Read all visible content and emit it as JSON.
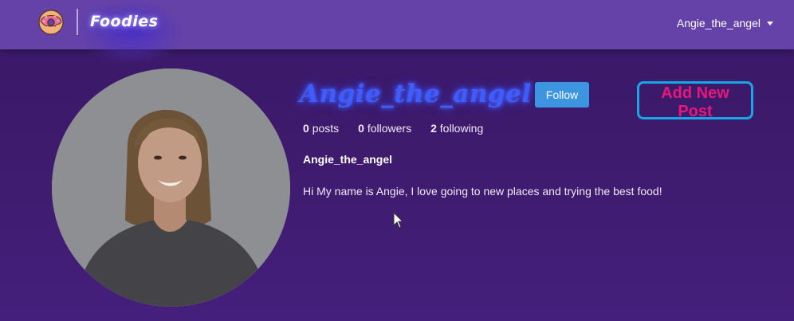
{
  "navbar": {
    "brand_name": "Foodies",
    "logo_icon": "donut-icon",
    "user_menu_label": "Angie_the_angel"
  },
  "profile": {
    "username": "Angie_the_angel",
    "follow_label": "Follow",
    "add_post_label": "Add New Post",
    "stats": {
      "posts_count": "0",
      "posts_label": "posts",
      "followers_count": "0",
      "followers_label": "followers",
      "following_count": "2",
      "following_label": "following"
    },
    "display_name": "Angie_the_angel",
    "bio": "Hi My name is Angie, I love going to new places and trying the best food!"
  },
  "colors": {
    "navbar": "#6442a8",
    "background": "#3e1b6d",
    "follow_button": "#3d95e2",
    "add_post_text": "#e9177c",
    "add_post_border": "#19a6e7",
    "username_glow": "#3f5cff"
  }
}
